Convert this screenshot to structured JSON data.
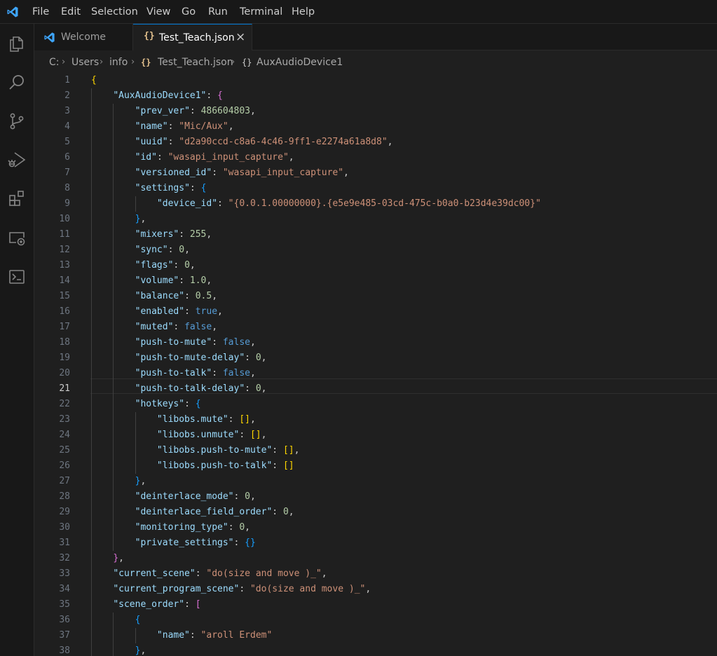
{
  "menu": [
    "File",
    "Edit",
    "Selection",
    "View",
    "Go",
    "Run",
    "Terminal",
    "Help"
  ],
  "activity_bar": [
    "explorer-icon",
    "search-icon",
    "source-control-icon",
    "run-debug-icon",
    "extensions-icon",
    "remote-explorer-icon",
    "terminal-icon"
  ],
  "tabs": [
    {
      "label": "Welcome",
      "icon": "vscode-icon",
      "active": false
    },
    {
      "label": "Test_Teach.json",
      "icon": "json-braces-icon",
      "active": true,
      "close": "×"
    }
  ],
  "breadcrumb": {
    "items": [
      "C:",
      "Users",
      "info",
      "Test_Teach.json",
      "AuxAudioDevice1"
    ],
    "file_icon": "{}",
    "symbol_icon": "{}"
  },
  "editor": {
    "active_line": 21,
    "colors": {
      "key": "#9cdcfe",
      "string": "#ce9178",
      "number": "#b5cea8",
      "keyword": "#569cd6",
      "bracket1": "#ffd700",
      "bracket2": "#da70d6",
      "bracket3": "#179fff"
    },
    "lines": [
      {
        "n": 1,
        "indent": 0,
        "tokens": [
          [
            "br1",
            "{"
          ]
        ]
      },
      {
        "n": 2,
        "indent": 1,
        "tokens": [
          [
            "k",
            "\"AuxAudioDevice1\""
          ],
          [
            "p",
            ": "
          ],
          [
            "br2",
            "{"
          ]
        ]
      },
      {
        "n": 3,
        "indent": 2,
        "tokens": [
          [
            "k",
            "\"prev_ver\""
          ],
          [
            "p",
            ": "
          ],
          [
            "n",
            "486604803"
          ],
          [
            "p",
            ","
          ]
        ]
      },
      {
        "n": 4,
        "indent": 2,
        "tokens": [
          [
            "k",
            "\"name\""
          ],
          [
            "p",
            ": "
          ],
          [
            "s",
            "\"Mic/Aux\""
          ],
          [
            "p",
            ","
          ]
        ]
      },
      {
        "n": 5,
        "indent": 2,
        "tokens": [
          [
            "k",
            "\"uuid\""
          ],
          [
            "p",
            ": "
          ],
          [
            "s",
            "\"d2a90ccd-c8a6-4c46-9ff1-e2274a61a8d8\""
          ],
          [
            "p",
            ","
          ]
        ]
      },
      {
        "n": 6,
        "indent": 2,
        "tokens": [
          [
            "k",
            "\"id\""
          ],
          [
            "p",
            ": "
          ],
          [
            "s",
            "\"wasapi_input_capture\""
          ],
          [
            "p",
            ","
          ]
        ]
      },
      {
        "n": 7,
        "indent": 2,
        "tokens": [
          [
            "k",
            "\"versioned_id\""
          ],
          [
            "p",
            ": "
          ],
          [
            "s",
            "\"wasapi_input_capture\""
          ],
          [
            "p",
            ","
          ]
        ]
      },
      {
        "n": 8,
        "indent": 2,
        "tokens": [
          [
            "k",
            "\"settings\""
          ],
          [
            "p",
            ": "
          ],
          [
            "br3",
            "{"
          ]
        ]
      },
      {
        "n": 9,
        "indent": 3,
        "tokens": [
          [
            "k",
            "\"device_id\""
          ],
          [
            "p",
            ": "
          ],
          [
            "s",
            "\"{0.0.1.00000000}.{e5e9e485-03cd-475c-b0a0-b23d4e39dc00}\""
          ]
        ]
      },
      {
        "n": 10,
        "indent": 2,
        "tokens": [
          [
            "br3",
            "}"
          ],
          [
            "p",
            ","
          ]
        ]
      },
      {
        "n": 11,
        "indent": 2,
        "tokens": [
          [
            "k",
            "\"mixers\""
          ],
          [
            "p",
            ": "
          ],
          [
            "n",
            "255"
          ],
          [
            "p",
            ","
          ]
        ]
      },
      {
        "n": 12,
        "indent": 2,
        "tokens": [
          [
            "k",
            "\"sync\""
          ],
          [
            "p",
            ": "
          ],
          [
            "n",
            "0"
          ],
          [
            "p",
            ","
          ]
        ]
      },
      {
        "n": 13,
        "indent": 2,
        "tokens": [
          [
            "k",
            "\"flags\""
          ],
          [
            "p",
            ": "
          ],
          [
            "n",
            "0"
          ],
          [
            "p",
            ","
          ]
        ]
      },
      {
        "n": 14,
        "indent": 2,
        "tokens": [
          [
            "k",
            "\"volume\""
          ],
          [
            "p",
            ": "
          ],
          [
            "n",
            "1.0"
          ],
          [
            "p",
            ","
          ]
        ]
      },
      {
        "n": 15,
        "indent": 2,
        "tokens": [
          [
            "k",
            "\"balance\""
          ],
          [
            "p",
            ": "
          ],
          [
            "n",
            "0.5"
          ],
          [
            "p",
            ","
          ]
        ]
      },
      {
        "n": 16,
        "indent": 2,
        "tokens": [
          [
            "k",
            "\"enabled\""
          ],
          [
            "p",
            ": "
          ],
          [
            "b",
            "true"
          ],
          [
            "p",
            ","
          ]
        ]
      },
      {
        "n": 17,
        "indent": 2,
        "tokens": [
          [
            "k",
            "\"muted\""
          ],
          [
            "p",
            ": "
          ],
          [
            "b",
            "false"
          ],
          [
            "p",
            ","
          ]
        ]
      },
      {
        "n": 18,
        "indent": 2,
        "tokens": [
          [
            "k",
            "\"push-to-mute\""
          ],
          [
            "p",
            ": "
          ],
          [
            "b",
            "false"
          ],
          [
            "p",
            ","
          ]
        ]
      },
      {
        "n": 19,
        "indent": 2,
        "tokens": [
          [
            "k",
            "\"push-to-mute-delay\""
          ],
          [
            "p",
            ": "
          ],
          [
            "n",
            "0"
          ],
          [
            "p",
            ","
          ]
        ]
      },
      {
        "n": 20,
        "indent": 2,
        "tokens": [
          [
            "k",
            "\"push-to-talk\""
          ],
          [
            "p",
            ": "
          ],
          [
            "b",
            "false"
          ],
          [
            "p",
            ","
          ]
        ]
      },
      {
        "n": 21,
        "indent": 2,
        "tokens": [
          [
            "k",
            "\"push-to-talk-delay\""
          ],
          [
            "p",
            ": "
          ],
          [
            "n",
            "0"
          ],
          [
            "p",
            ","
          ]
        ]
      },
      {
        "n": 22,
        "indent": 2,
        "tokens": [
          [
            "k",
            "\"hotkeys\""
          ],
          [
            "p",
            ": "
          ],
          [
            "br3",
            "{"
          ]
        ]
      },
      {
        "n": 23,
        "indent": 3,
        "tokens": [
          [
            "k",
            "\"libobs.mute\""
          ],
          [
            "p",
            ": "
          ],
          [
            "br1",
            "[]"
          ],
          [
            "p",
            ","
          ]
        ]
      },
      {
        "n": 24,
        "indent": 3,
        "tokens": [
          [
            "k",
            "\"libobs.unmute\""
          ],
          [
            "p",
            ": "
          ],
          [
            "br1",
            "[]"
          ],
          [
            "p",
            ","
          ]
        ]
      },
      {
        "n": 25,
        "indent": 3,
        "tokens": [
          [
            "k",
            "\"libobs.push-to-mute\""
          ],
          [
            "p",
            ": "
          ],
          [
            "br1",
            "[]"
          ],
          [
            "p",
            ","
          ]
        ]
      },
      {
        "n": 26,
        "indent": 3,
        "tokens": [
          [
            "k",
            "\"libobs.push-to-talk\""
          ],
          [
            "p",
            ": "
          ],
          [
            "br1",
            "[]"
          ]
        ]
      },
      {
        "n": 27,
        "indent": 2,
        "tokens": [
          [
            "br3",
            "}"
          ],
          [
            "p",
            ","
          ]
        ]
      },
      {
        "n": 28,
        "indent": 2,
        "tokens": [
          [
            "k",
            "\"deinterlace_mode\""
          ],
          [
            "p",
            ": "
          ],
          [
            "n",
            "0"
          ],
          [
            "p",
            ","
          ]
        ]
      },
      {
        "n": 29,
        "indent": 2,
        "tokens": [
          [
            "k",
            "\"deinterlace_field_order\""
          ],
          [
            "p",
            ": "
          ],
          [
            "n",
            "0"
          ],
          [
            "p",
            ","
          ]
        ]
      },
      {
        "n": 30,
        "indent": 2,
        "tokens": [
          [
            "k",
            "\"monitoring_type\""
          ],
          [
            "p",
            ": "
          ],
          [
            "n",
            "0"
          ],
          [
            "p",
            ","
          ]
        ]
      },
      {
        "n": 31,
        "indent": 2,
        "tokens": [
          [
            "k",
            "\"private_settings\""
          ],
          [
            "p",
            ": "
          ],
          [
            "br3",
            "{}"
          ]
        ]
      },
      {
        "n": 32,
        "indent": 1,
        "tokens": [
          [
            "br2",
            "}"
          ],
          [
            "p",
            ","
          ]
        ]
      },
      {
        "n": 33,
        "indent": 1,
        "tokens": [
          [
            "k",
            "\"current_scene\""
          ],
          [
            "p",
            ": "
          ],
          [
            "s",
            "\"do(size and move )_\""
          ],
          [
            "p",
            ","
          ]
        ]
      },
      {
        "n": 34,
        "indent": 1,
        "tokens": [
          [
            "k",
            "\"current_program_scene\""
          ],
          [
            "p",
            ": "
          ],
          [
            "s",
            "\"do(size and move )_\""
          ],
          [
            "p",
            ","
          ]
        ]
      },
      {
        "n": 35,
        "indent": 1,
        "tokens": [
          [
            "k",
            "\"scene_order\""
          ],
          [
            "p",
            ": "
          ],
          [
            "br2",
            "["
          ]
        ]
      },
      {
        "n": 36,
        "indent": 2,
        "tokens": [
          [
            "br3",
            "{"
          ]
        ]
      },
      {
        "n": 37,
        "indent": 3,
        "tokens": [
          [
            "k",
            "\"name\""
          ],
          [
            "p",
            ": "
          ],
          [
            "s",
            "\"aroll Erdem\""
          ]
        ]
      },
      {
        "n": 38,
        "indent": 2,
        "tokens": [
          [
            "br3",
            "}"
          ],
          [
            "p",
            ","
          ]
        ]
      }
    ]
  }
}
